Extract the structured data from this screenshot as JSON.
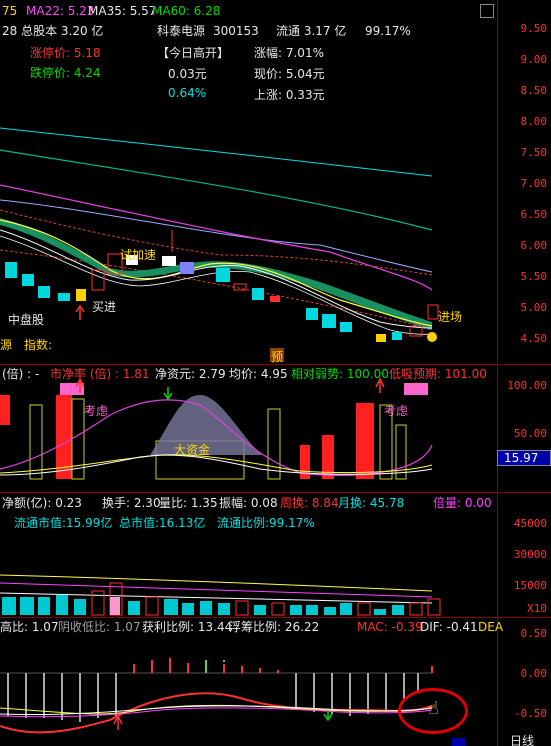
{
  "header": {
    "ma5_tail": "75",
    "ma22": "MA22: 5.23",
    "ma35": "MA35: 5.57",
    "ma60": "MA60: 6.28",
    "total_shares": "28  总股本 3.20 亿",
    "stock_name": "科泰电源",
    "stock_code": "300153",
    "float_shares": "流通 3.17 亿",
    "float_pct": "99.17%",
    "limit_up": "涨停价:  5.18",
    "limit_down": "跌停价:  4.24",
    "open_note": "【今日高开】",
    "open_amount": "0.03元",
    "open_pct": "0.64%",
    "change_pct": "涨幅:   7.01%",
    "price": "现价:   5.04元",
    "rise": "上涨:   0.33元"
  },
  "price_chart": {
    "ticks": [
      "9.50",
      "9.00",
      "8.50",
      "8.00",
      "7.50",
      "7.00",
      "6.50",
      "6.00",
      "5.50",
      "5.00",
      "4.50"
    ],
    "labels": {
      "try_accel": "试加速",
      "buy_in": "买进",
      "mid_term": "中盘股",
      "enter": "进场",
      "source_label": "源",
      "index_label": "指数:",
      "preview": "预"
    }
  },
  "indicator_pe": {
    "title_left": "(倍) : -",
    "pe_label": "市净率 (倍) : 1.81",
    "nav": "净资元: 2.79",
    "avg": "均价: 4.95",
    "relative_weak": "相对弱势: 100.00",
    "extra": "低吸预期: 101.00",
    "consider_1": "考虑",
    "consider_2": "考虑",
    "big_funds": "大资金",
    "ticks": [
      "100.00",
      "50.00"
    ],
    "highlight_value": "15.97"
  },
  "indicator_volume": {
    "net_amount": "净额(亿): 0.23",
    "turnover_hand": "换手: 2.30",
    "volume_ratio": "量比: 1.35",
    "amplitude": "振幅: 0.08",
    "weekly_turnover": "周换: 8.84",
    "monthly_turnover": "月换: 45.78",
    "multiple": "倍量: 0.00",
    "float_mcap": "流通市值:15.99亿",
    "total_mcap": "总市值:16.13亿",
    "float_ratio": "流通比例:99.17%",
    "ticks": [
      "45000",
      "30000",
      "15000",
      "X10"
    ]
  },
  "indicator_macd": {
    "high_ratio": "高比: 1.07",
    "low_ratio": "阴收低比: 1.07",
    "profit_ratio": "获利比例: 13.44",
    "float_chip": "浮筹比例: 26.22",
    "mac": "MAC: -0.39",
    "dif": "DIF: -0.41",
    "dea": "DEA",
    "ticks": [
      "0.50",
      "0.00",
      "-0.50"
    ],
    "bottom_right": "日线"
  },
  "colors": {
    "up": "#ff3030",
    "down": "#00e0e0",
    "axis": "#8b0000",
    "highlight_circle": "#e00000"
  }
}
